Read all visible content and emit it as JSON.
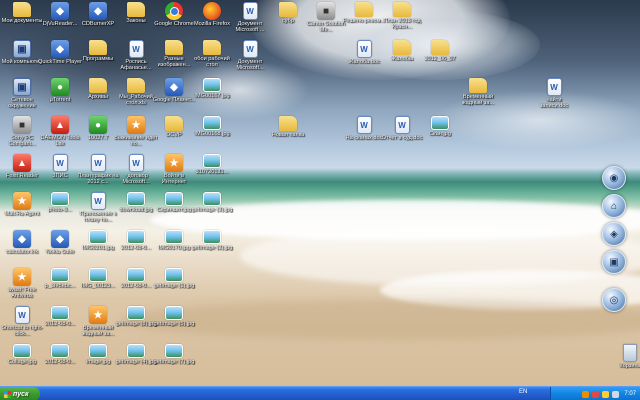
{
  "desktop": {
    "icons": [
      {
        "id": "my-documents",
        "label": "Мои документы",
        "glyph": "folder",
        "icon": "folder-icon"
      },
      {
        "id": "djvu-reader",
        "label": "DjVuReader...",
        "glyph": "app",
        "icon": "app-icon"
      },
      {
        "id": "cdburnerxp",
        "label": "CDBurnerXP",
        "glyph": "app",
        "icon": "disc-icon"
      },
      {
        "id": "zakony",
        "label": "Законы",
        "glyph": "folder",
        "icon": "folder-icon"
      },
      {
        "id": "google-chrome",
        "label": "Google Chrome",
        "glyph": "chrome",
        "icon": "chrome-icon"
      },
      {
        "id": "mozilla-firefox",
        "label": "Mozilla Firefox",
        "glyph": "firefox",
        "icon": "firefox-icon"
      },
      {
        "id": "doc-microsoft-1",
        "label": "Документ Microsoft ...",
        "glyph": "doc",
        "icon": "word-doc-icon"
      },
      {
        "id": "subr",
        "label": "субр",
        "glyph": "folder",
        "icon": "folder-icon"
      },
      {
        "id": "canon-solution",
        "label": "Canon Solution Me...",
        "glyph": "gray",
        "icon": "printer-icon"
      },
      {
        "id": "reshenie",
        "label": "Решено реком...",
        "glyph": "folder",
        "icon": "folder-icon"
      },
      {
        "id": "plan-2013",
        "label": "План 2013 год Красн...",
        "glyph": "folder",
        "icon": "folder-icon"
      },
      {
        "id": "my-computer",
        "label": "Мой компьютер",
        "glyph": "pc",
        "icon": "computer-icon"
      },
      {
        "id": "quicktime",
        "label": "QuickTime Player",
        "glyph": "app",
        "icon": "quicktime-icon"
      },
      {
        "id": "programmy",
        "label": "Программы",
        "glyph": "folder",
        "icon": "folder-icon"
      },
      {
        "id": "rospis",
        "label": "Роспись Афанасье...",
        "glyph": "doc",
        "icon": "word-doc-icon"
      },
      {
        "id": "raznye",
        "label": "Разные изображен...",
        "glyph": "folder",
        "icon": "folder-icon"
      },
      {
        "id": "oboi",
        "label": "обои рабочий стол",
        "glyph": "folder",
        "icon": "folder-icon"
      },
      {
        "id": "doc-microsoft-2",
        "label": "Документ Microsoft...",
        "glyph": "doc",
        "icon": "word-doc-icon"
      },
      {
        "id": "zhaloba-doc",
        "label": "Жалоба.doc",
        "glyph": "doc",
        "icon": "word-doc-icon"
      },
      {
        "id": "zhaloby",
        "label": "Жалобы",
        "glyph": "folder",
        "icon": "folder-icon"
      },
      {
        "id": "folder-2012",
        "label": "2012_06_07",
        "glyph": "folder",
        "icon": "folder-icon"
      },
      {
        "id": "network",
        "label": "Сетевое окружение",
        "glyph": "pc",
        "icon": "network-icon"
      },
      {
        "id": "utorrent",
        "label": "µTorrent",
        "glyph": "green",
        "icon": "utorrent-icon"
      },
      {
        "id": "arhivy",
        "label": "Архивы",
        "glyph": "folder",
        "icon": "folder-icon"
      },
      {
        "id": "my-desktop",
        "label": "Мы_Рабочий стол.xls",
        "glyph": "folder",
        "icon": "folder-icon"
      },
      {
        "id": "google-earth",
        "label": "Google Планет...",
        "glyph": "app",
        "icon": "earth-icon"
      },
      {
        "id": "img-1",
        "label": "IMG00167.jpg",
        "glyph": "img",
        "icon": "image-icon"
      },
      {
        "id": "vremenny",
        "label": "Временный жадный за...",
        "glyph": "folder",
        "icon": "folder-icon"
      },
      {
        "id": "najti",
        "label": "найти записи.doc",
        "glyph": "doc",
        "icon": "word-doc-icon"
      },
      {
        "id": "sony",
        "label": "Sony PC Compani...",
        "glyph": "gray",
        "icon": "sony-icon"
      },
      {
        "id": "daemon",
        "label": "DAEMON Tools Lite",
        "glyph": "red",
        "icon": "daemon-icon"
      },
      {
        "id": "b10",
        "label": "10027.7",
        "glyph": "green",
        "icon": "app-icon"
      },
      {
        "id": "vyzhivanie",
        "label": "Выживание идет по...",
        "glyph": "orange",
        "icon": "app-icon"
      },
      {
        "id": "dcvp",
        "label": "DCVP",
        "glyph": "folder",
        "icon": "folder-icon"
      },
      {
        "id": "img-2",
        "label": "IMG00168.jpg",
        "glyph": "img",
        "icon": "image-icon"
      },
      {
        "id": "novaya-papka",
        "label": "Новая папка",
        "glyph": "folder",
        "icon": "folder-icon"
      },
      {
        "id": "iz-scan",
        "label": "На сканах.doc",
        "glyph": "doc",
        "icon": "word-doc-icon"
      },
      {
        "id": "otchet",
        "label": "Отчет в суд.doc",
        "glyph": "doc",
        "icon": "word-doc-icon"
      },
      {
        "id": "scan-img",
        "label": "Скан.jpg",
        "glyph": "img",
        "icon": "image-icon"
      },
      {
        "id": "foxit",
        "label": "Foxit Reader",
        "glyph": "red",
        "icon": "foxit-icon"
      },
      {
        "id": "zpis",
        "label": "ЗПИС",
        "glyph": "doc",
        "icon": "word-doc-icon"
      },
      {
        "id": "plan-grafik",
        "label": "План график на 2012 с...",
        "glyph": "doc",
        "icon": "excel-doc-icon"
      },
      {
        "id": "dogovor",
        "label": "~договор Microsoft...",
        "glyph": "doc",
        "icon": "word-doc-icon"
      },
      {
        "id": "vojti",
        "label": "Войти в Интернет",
        "glyph": "orange",
        "icon": "internet-icon"
      },
      {
        "id": "img-3",
        "label": "310720131...",
        "glyph": "img",
        "icon": "image-icon"
      },
      {
        "id": "mail-agent",
        "label": "Mail.Ru Agent",
        "glyph": "orange",
        "icon": "mail-agent-icon"
      },
      {
        "id": "photo-3",
        "label": "photo-3...",
        "glyph": "img",
        "icon": "image-icon"
      },
      {
        "id": "prilozhenie",
        "label": "Приложение к плану по...",
        "glyph": "doc",
        "icon": "word-doc-icon"
      },
      {
        "id": "download",
        "label": "download.jpg",
        "glyph": "img",
        "icon": "image-icon"
      },
      {
        "id": "screenshot",
        "label": "Скриншот.jpg",
        "glyph": "img",
        "icon": "image-icon"
      },
      {
        "id": "getimage-1",
        "label": "getImage (3).jpg",
        "glyph": "img",
        "icon": "image-icon"
      },
      {
        "id": "calculator",
        "label": "calculator.lnk",
        "glyph": "app",
        "icon": "calculator-icon"
      },
      {
        "id": "nokia-suite",
        "label": "Nokia Suite",
        "glyph": "app",
        "icon": "nokia-icon"
      },
      {
        "id": "img-4",
        "label": "IMG0201.jpg",
        "glyph": "img",
        "icon": "image-icon"
      },
      {
        "id": "img-5",
        "label": "2012-08-0...",
        "glyph": "img",
        "icon": "image-icon"
      },
      {
        "id": "img-6",
        "label": "IMG0170.jpg",
        "glyph": "img",
        "icon": "image-icon"
      },
      {
        "id": "getimage-2",
        "label": "getImage (2).jpg",
        "glyph": "img",
        "icon": "image-icon"
      },
      {
        "id": "avast",
        "label": "avast! Free Antivirus",
        "glyph": "orange",
        "icon": "avast-icon"
      },
      {
        "id": "img-7",
        "label": "p_3fe5ebc...",
        "glyph": "img",
        "icon": "image-icon"
      },
      {
        "id": "img-8",
        "label": "IMG_00123...",
        "glyph": "img",
        "icon": "image-icon"
      },
      {
        "id": "img-9",
        "label": "2012-08-0...",
        "glyph": "img",
        "icon": "image-icon"
      },
      {
        "id": "getimage-3",
        "label": "getImage (1).jpg",
        "glyph": "img",
        "icon": "image-icon"
      },
      {
        "id": "shortcut",
        "label": "Shortcut to right-click...",
        "glyph": "doc",
        "icon": "shortcut-icon"
      },
      {
        "id": "img-10",
        "label": "2012-08-0...",
        "glyph": "img",
        "icon": "image-icon"
      },
      {
        "id": "vremenny-2",
        "label": "Временный жадный за...",
        "glyph": "orange",
        "icon": "archive-icon"
      },
      {
        "id": "getimage-4",
        "label": "getImage (8).jpg",
        "glyph": "img",
        "icon": "image-icon"
      },
      {
        "id": "getimage-5",
        "label": "getImage (5).jpg",
        "glyph": "img",
        "icon": "image-icon"
      },
      {
        "id": "collage",
        "label": "Collage.jpg",
        "glyph": "img",
        "icon": "image-icon"
      },
      {
        "id": "img-11",
        "label": "2012-08-0...",
        "glyph": "img",
        "icon": "image-icon"
      },
      {
        "id": "img-12",
        "label": "Image.jpg",
        "glyph": "img",
        "icon": "image-icon"
      },
      {
        "id": "getimage-6",
        "label": "getImage (4).jpg",
        "glyph": "img",
        "icon": "image-icon"
      },
      {
        "id": "getimage-7",
        "label": "getImage (7).jpg",
        "glyph": "img",
        "icon": "image-icon"
      },
      {
        "id": "recycle-bin",
        "label": "Корзина",
        "glyph": "recycle",
        "icon": "recycle-bin-icon"
      }
    ]
  },
  "dock": {
    "buttons": [
      {
        "icon": "remote-icon",
        "glyph": "◉"
      },
      {
        "icon": "mouse-icon",
        "glyph": "⌂"
      },
      {
        "icon": "network-map-icon",
        "glyph": "◈"
      },
      {
        "icon": "display-icon",
        "glyph": "▣"
      },
      {
        "icon": "disc-drive-icon",
        "glyph": "◎"
      }
    ]
  },
  "taskbar": {
    "start_label": "пуск",
    "language": "EN",
    "clock": "7:07",
    "colors": {
      "start": "#3a9a2e",
      "bar": "#245ed1",
      "tray": "#1183e3"
    }
  }
}
